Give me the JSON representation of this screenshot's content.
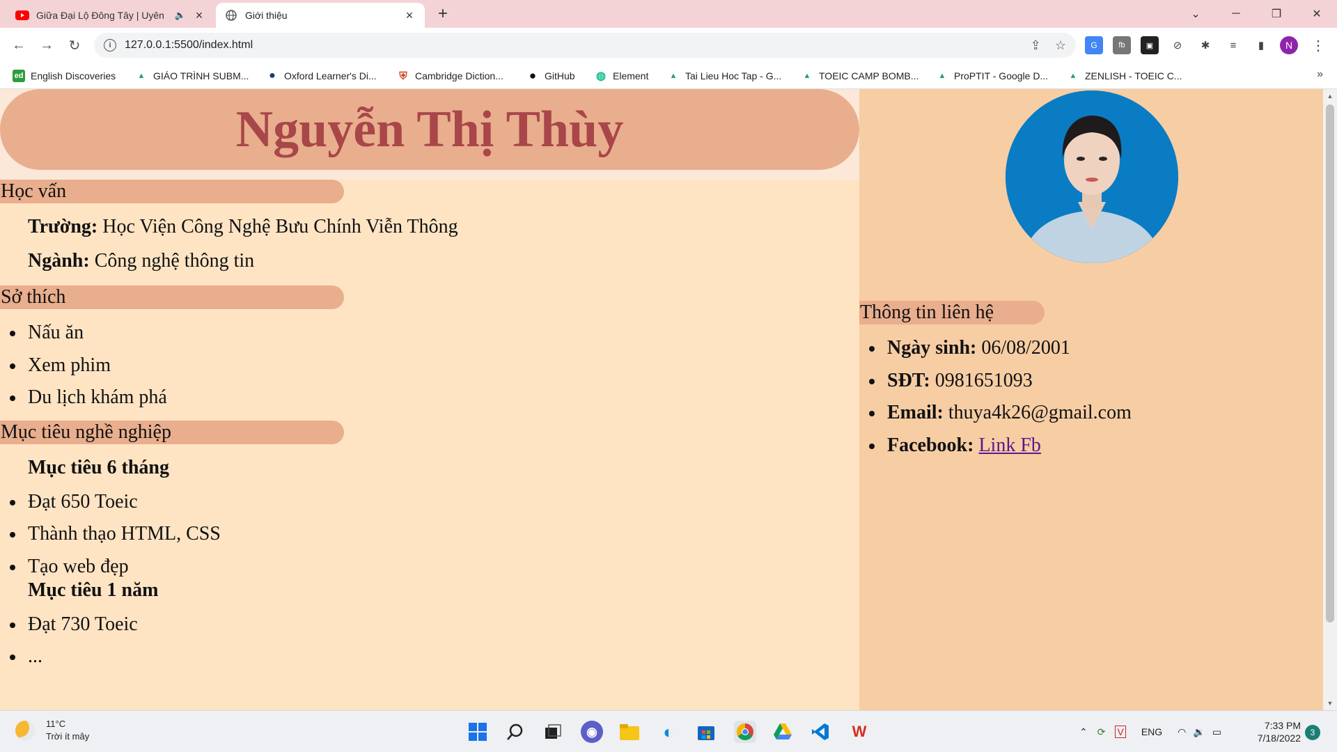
{
  "browser": {
    "tabs": [
      {
        "title": "Giữa Đại Lộ Đông Tây | Uyên",
        "icon": "youtube-icon",
        "audio": "speaker-icon"
      },
      {
        "title": "Giới thiệu",
        "icon": "globe-icon"
      }
    ],
    "new_tab_label": "+",
    "address": "127.0.0.1:5500/index.html",
    "profile_initial": "N",
    "bookmarks": [
      {
        "label": "English Discoveries",
        "icon_text": "ed",
        "color": "#2e9b3e"
      },
      {
        "label": "GIÁO TRÌNH SUBM...",
        "icon_text": "▲",
        "color": "#1fa463"
      },
      {
        "label": "Oxford Learner's Di...",
        "icon_text": "●",
        "color": "#1d3b7a"
      },
      {
        "label": "Cambridge Diction...",
        "icon_text": "⛨",
        "color": "#c8431c"
      },
      {
        "label": "GitHub",
        "icon_text": "●",
        "color": "#111111"
      },
      {
        "label": "Element",
        "icon_text": "◍",
        "color": "#0dbd8b"
      },
      {
        "label": "Tai Lieu Hoc Tap - G...",
        "icon_text": "▲",
        "color": "#1fa463"
      },
      {
        "label": "TOEIC CAMP BOMB...",
        "icon_text": "▲",
        "color": "#1fa463"
      },
      {
        "label": "ProPTIT - Google D...",
        "icon_text": "▲",
        "color": "#1fa463"
      },
      {
        "label": "ZENLISH - TOEIC C...",
        "icon_text": "▲",
        "color": "#1fa463"
      }
    ],
    "bookmarks_more": "»"
  },
  "page": {
    "name": "Nguyễn Thị Thùy",
    "education": {
      "heading": "Học vấn",
      "school_label": "Trường:",
      "school_value": "Học Viện Công Nghệ Bưu Chính Viễn Thông",
      "major_label": "Ngành:",
      "major_value": "Công nghệ thông tin"
    },
    "hobbies": {
      "heading": "Sở thích",
      "items": [
        "Nấu ăn",
        "Xem phim",
        "Du lịch khám phá"
      ]
    },
    "career": {
      "heading": "Mục tiêu nghề nghiệp",
      "goal_6m_title": "Mục tiêu 6 tháng",
      "goal_6m_items": [
        "Đạt 650 Toeic",
        "Thành thạo HTML, CSS",
        "Tạo web đẹp"
      ],
      "goal_1y_title": "Mục tiêu 1 năm",
      "goal_1y_items": [
        "Đạt 730 Toeic",
        "..."
      ]
    },
    "contact": {
      "heading": "Thông tin liên hệ",
      "dob_label": "Ngày sinh:",
      "dob_value": "06/08/2001",
      "phone_label": "SĐT:",
      "phone_value": "0981651093",
      "email_label": "Email:",
      "email_value": "thuya4k26@gmail.com",
      "facebook_label": "Facebook:",
      "facebook_link": "Link Fb"
    },
    "colors": {
      "background": "#ffe4c4",
      "right_panel": "#f7cda4",
      "accent": "#e9ae8d",
      "title": "#a8464a"
    }
  },
  "taskbar": {
    "weather_temp": "11°C",
    "weather_desc": "Trời ít mây",
    "language": "ENG",
    "time": "7:33 PM",
    "date": "7/18/2022",
    "notifications": "3"
  }
}
